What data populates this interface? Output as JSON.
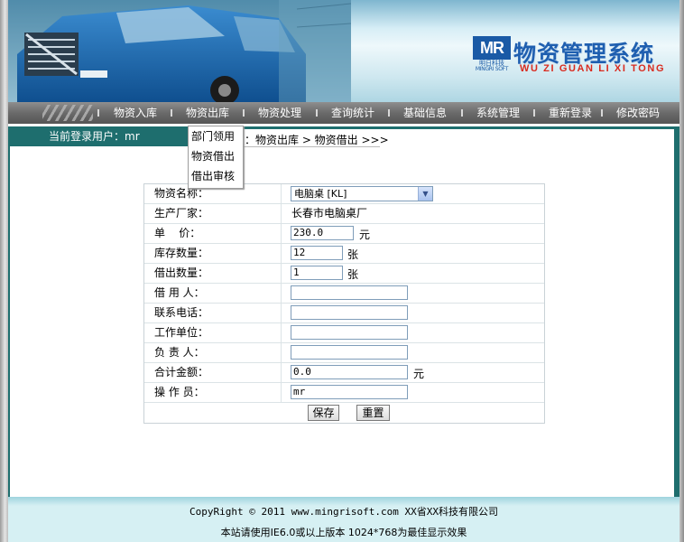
{
  "header": {
    "logo_text": "MR",
    "logo_cn": "明日科技",
    "logo_en": "MINGRI SOFT",
    "title": "物资管理系统",
    "subtitle": "WU ZI GUAN LI XI TONG"
  },
  "nav": {
    "items": [
      {
        "label": "物资入库"
      },
      {
        "label": "物资出库"
      },
      {
        "label": "物资处理"
      },
      {
        "label": "查询统计"
      },
      {
        "label": "基础信息"
      },
      {
        "label": "系统管理"
      },
      {
        "label": "重新登录"
      },
      {
        "label": "修改密码"
      }
    ]
  },
  "dropdown": {
    "items": [
      "部门领用",
      "物资借出",
      "借出审核"
    ]
  },
  "userbar": {
    "current_user": "当前登录用户：mr",
    "breadcrumb": "置：物资出库 > 物资借出 >>>"
  },
  "form": {
    "rows": [
      {
        "label": "物资名称：",
        "type": "select",
        "value": "电脑桌 [KL]"
      },
      {
        "label": "生产厂家：",
        "type": "text",
        "value": "长春市电脑桌厂"
      },
      {
        "label": "单    价：",
        "type": "input",
        "value": "230.0",
        "unit": "元"
      },
      {
        "label": "库存数量：",
        "type": "input",
        "value": "12",
        "unit": "张"
      },
      {
        "label": "借出数量：",
        "type": "input",
        "value": "1",
        "unit": "张"
      },
      {
        "label": "借 用 人：",
        "type": "input",
        "value": ""
      },
      {
        "label": "联系电话：",
        "type": "input",
        "value": ""
      },
      {
        "label": "工作单位：",
        "type": "input",
        "value": ""
      },
      {
        "label": "负 责 人：",
        "type": "input",
        "value": ""
      },
      {
        "label": "合计金额：",
        "type": "input",
        "value": "0.0",
        "unit": "元"
      },
      {
        "label": "操 作 员：",
        "type": "input",
        "value": "mr"
      }
    ],
    "save_label": "保存",
    "reset_label": "重置"
  },
  "footer": {
    "line1": "CopyRight © 2011 www.mingrisoft.com XX省XX科技有限公司",
    "line2": "本站请使用IE6.0或以上版本 1024*768为最佳显示效果"
  },
  "colors": {
    "teal": "#1e6e6e",
    "nav_bg": "#6a6a6a",
    "title_blue": "#1f5fb0",
    "subtitle_red": "#d92a1e"
  }
}
